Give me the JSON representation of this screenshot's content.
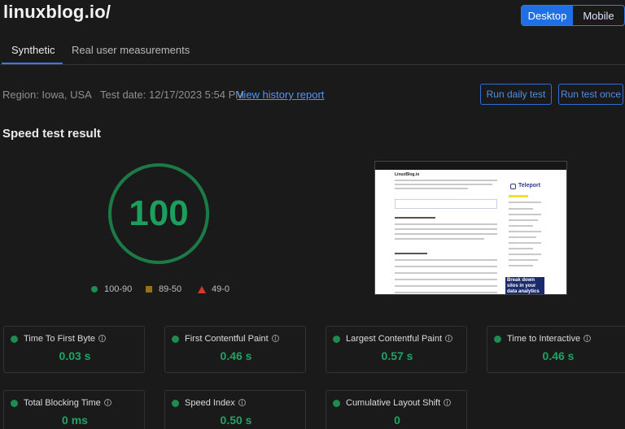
{
  "site": {
    "title": "linuxblog.io/"
  },
  "device_toggle": {
    "desktop": "Desktop",
    "mobile": "Mobile",
    "selected": "Desktop"
  },
  "tabs": [
    {
      "label": "Synthetic",
      "active": true
    },
    {
      "label": "Real user measurements",
      "active": false
    }
  ],
  "test_info": {
    "region": "Region: Iowa, USA",
    "test_date": "Test date: 12/17/2023 5:54 PM",
    "history_link": "View history report"
  },
  "actions": {
    "run_daily": "Run daily test",
    "run_once": "Run test once"
  },
  "result": {
    "heading": "Speed test result",
    "score": "100",
    "score_fraction": 1.0,
    "colors": {
      "good": "#1c9e5c",
      "average": "#9a6f15",
      "poor": "#d23a2a",
      "accent": "#1f6fe5"
    }
  },
  "legend": [
    {
      "label": "100-90",
      "icon": "green-circle-icon"
    },
    {
      "label": "89-50",
      "icon": "amber-square-icon"
    },
    {
      "label": "49-0",
      "icon": "red-triangle-icon"
    }
  ],
  "screenshot": {
    "site_title": "LinuxBlog.io",
    "sidebar_brand": "Teleport",
    "ad_text": "Break down silos in your data analytics stack"
  },
  "metrics": [
    {
      "label": "Time To First Byte",
      "value": "0.03 s"
    },
    {
      "label": "First Contentful Paint",
      "value": "0.46 s"
    },
    {
      "label": "Largest Contentful Paint",
      "value": "0.57 s"
    },
    {
      "label": "Time to Interactive",
      "value": "0.46 s"
    },
    {
      "label": "Total Blocking Time",
      "value": "0 ms"
    },
    {
      "label": "Speed Index",
      "value": "0.50 s"
    },
    {
      "label": "Cumulative Layout Shift",
      "value": "0"
    }
  ]
}
